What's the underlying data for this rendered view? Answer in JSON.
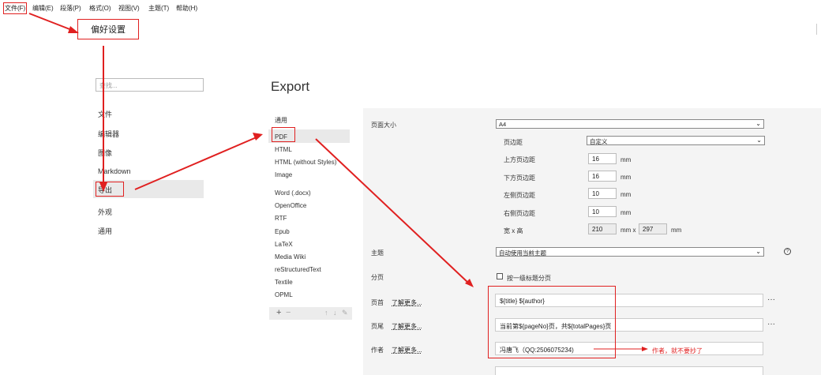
{
  "menubar": {
    "items": [
      "文件(F)",
      "编辑(E)",
      "段落(P)",
      "格式(O)",
      "视图(V)",
      "主题(T)",
      "帮助(H)"
    ]
  },
  "popup": {
    "label": "偏好设置"
  },
  "prefs": {
    "search_placeholder": "查找...",
    "categories": [
      "文件",
      "编辑器",
      "图像",
      "Markdown",
      "导出",
      "外观",
      "通用"
    ]
  },
  "export": {
    "title": "Export",
    "formats": [
      "通用",
      "PDF",
      "HTML",
      "HTML (without Styles)",
      "Image",
      "Word (.docx)",
      "OpenOffice",
      "RTF",
      "Epub",
      "LaTeX",
      "Media Wiki",
      "reStructuredText",
      "Textile",
      "OPML"
    ],
    "toolbar": {
      "add": "+",
      "remove": "−",
      "up": "↑",
      "down": "↓",
      "edit": "✎"
    }
  },
  "settings": {
    "page_size": {
      "label": "页面大小",
      "value": "A4"
    },
    "margin": {
      "label": "页边距",
      "value": "自定义"
    },
    "top_margin": {
      "label": "上方页边距",
      "value": "16",
      "unit": "mm"
    },
    "bottom_margin": {
      "label": "下方页边距",
      "value": "16",
      "unit": "mm"
    },
    "left_margin": {
      "label": "左侧页边距",
      "value": "10",
      "unit": "mm"
    },
    "right_margin": {
      "label": "右侧页边距",
      "value": "10",
      "unit": "mm"
    },
    "size": {
      "label": "宽 x 高",
      "width": "210",
      "sep": "mm x",
      "height": "297",
      "unit": "mm"
    },
    "theme": {
      "label": "主题",
      "value": "自动使用当前主题"
    },
    "pagination": {
      "label": "分页",
      "option": "按一级标题分页",
      "checked": false
    },
    "header": {
      "label": "页首",
      "learn_more": "了解更多...",
      "value": "${title} ${author}"
    },
    "footer": {
      "label": "页尾",
      "learn_more": "了解更多...",
      "value": "当前第${pageNo}页，共${totalPages}页"
    },
    "author": {
      "label": "作者",
      "learn_more": "了解更多...",
      "value": "冯唐飞（QQ:2506075234)"
    },
    "annotation": "作者，就不要抄了",
    "more": "···"
  },
  "colors": {
    "accent_red": "#e02020",
    "panel_bg": "#f4f4f4",
    "selected_bg": "#e9e9e9"
  },
  "icons": {
    "help": "help-circle-icon",
    "more": "more-icon",
    "chevron": "chevron-down-icon"
  }
}
